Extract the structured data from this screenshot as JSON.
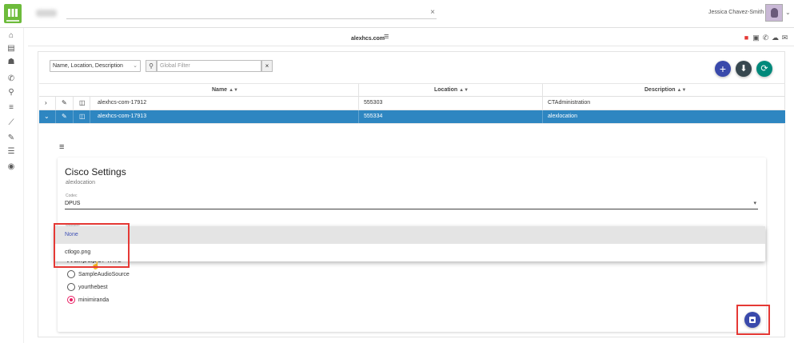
{
  "topbar": {
    "user_name": "Jessica Chavez-Smith",
    "search_clear": "×",
    "user_caret": "⌄"
  },
  "sidenav": {
    "icons": [
      "home-icon",
      "building-icon",
      "users-icon",
      "phone-icon",
      "location-icon",
      "list-icon",
      "magic-wand-icon",
      "brush-icon",
      "lines-icon",
      "compass-icon"
    ]
  },
  "subheader": {
    "domain": "alexhcs.com",
    "menu_glyph": "≡"
  },
  "filters": {
    "field_select": "Name, Location, Description",
    "global_filter_placeholder": "Global Filter",
    "clear_glyph": "×"
  },
  "actions": {
    "add": "+",
    "download": "⬇",
    "refresh": "⟳"
  },
  "table": {
    "columns": [
      "Name",
      "Location",
      "Description"
    ],
    "sort_glyph": "▲▼",
    "rows": [
      {
        "name": "alexhcs-com-17912",
        "location": "555303",
        "description": "CTAdministration",
        "expander": "›",
        "selected": false
      },
      {
        "name": "alexhcs-com-17913",
        "location": "555334",
        "description": "alexlocation",
        "expander": "⌄",
        "selected": true
      }
    ]
  },
  "detail": {
    "menu_glyph": "≡",
    "title": "Cisco Settings",
    "subtitle": "alexlocation",
    "codec_label": "Codec",
    "codec_value": "DPUS",
    "dropdown_hint": "Wallpaper",
    "dropdown_options": [
      "None",
      "ctlogo.png"
    ],
    "radio_options": [
      {
        "label": "SampleAudioSource",
        "checked": false
      },
      {
        "label": "yourthebest",
        "checked": false
      },
      {
        "label": "minimiranda",
        "checked": true
      }
    ]
  },
  "colors": {
    "accent": "#3949ab",
    "selected_row": "#2e86c1",
    "radio_on": "#e91e63",
    "highlight": "#e53935",
    "logo": "#6dbb3b"
  }
}
